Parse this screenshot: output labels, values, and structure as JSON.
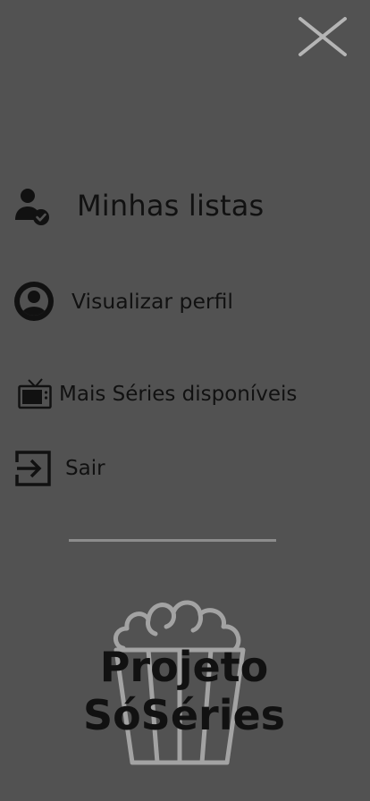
{
  "menu": {
    "close": {
      "icon": "close-icon"
    },
    "items": [
      {
        "label": "Minhas listas",
        "icon": "user-check-icon"
      },
      {
        "label": "Visualizar perfil",
        "icon": "account-circle-icon"
      },
      {
        "label": "Mais Séries disponíveis",
        "icon": "tv-icon"
      },
      {
        "label": "Sair",
        "icon": "exit-icon"
      }
    ]
  },
  "logo": {
    "line1": "Projeto",
    "line2": "SóSéries",
    "icon": "popcorn-icon"
  },
  "colors": {
    "background": "#525252",
    "text": "#111111",
    "close_icon": "#b5b5b5",
    "divider": "#8c8c8c",
    "popcorn_outline": "#a3a3a3"
  }
}
